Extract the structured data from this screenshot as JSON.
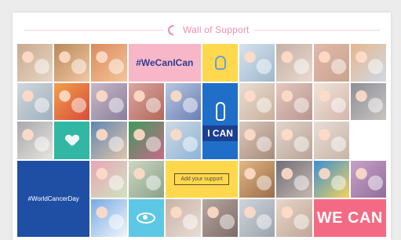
{
  "header": {
    "title": "Wall of Support",
    "icon": "crescent-icon"
  },
  "tiles": {
    "hashtag_top": "#WeCanICan",
    "hashtag_world": "#WorldCancerDay",
    "add_button": "Add your support",
    "ican": "I CAN",
    "wecan": "WE CAN"
  },
  "colors": {
    "pink": "#f7b7c8",
    "yellow": "#ffd84d",
    "navy": "#1f4fa5",
    "blue": "#1f6fc8",
    "teal": "#31b7a3",
    "cyan": "#5cc8e6",
    "coral": "#f46a84"
  }
}
